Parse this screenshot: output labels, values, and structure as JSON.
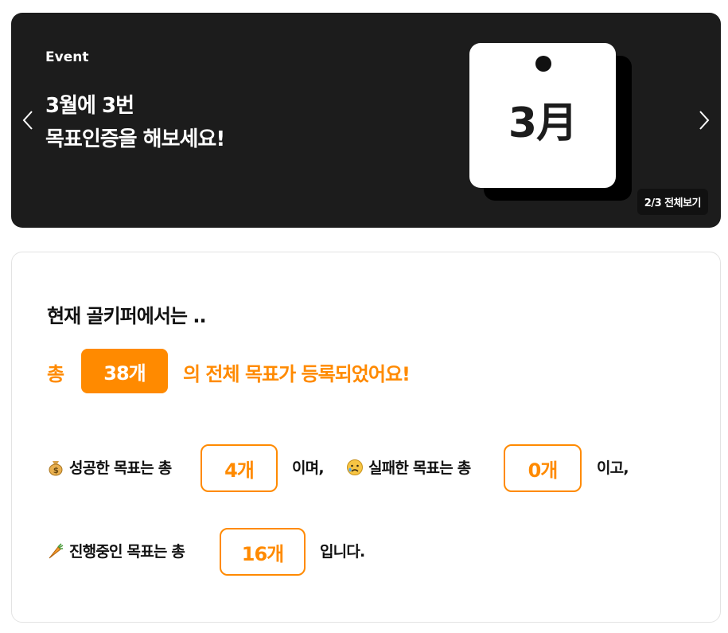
{
  "banner": {
    "event_label": "Event",
    "headline_line1": "3월에 3번",
    "headline_line2": "목표인증을 해보세요!",
    "calendar_month": "3月",
    "pager_text": "2/3 전체보기"
  },
  "stats": {
    "intro": "현재 골키퍼에서는 ..",
    "total_prefix": "총",
    "total_count": "38개",
    "total_suffix": "의 전체 목표가 등록되었어요!",
    "success_label": "성공한 목표는 총",
    "success_count": "4개",
    "success_suffix": "이며,",
    "fail_label": "실패한 목표는 총",
    "fail_count": "0개",
    "fail_suffix": "이고,",
    "progress_label": "진행중인 목표는 총",
    "progress_count": "16개",
    "progress_suffix": "입니다."
  },
  "icons": {
    "success": "money-bag-icon",
    "fail": "sad-face-icon",
    "progress": "carrot-icon"
  },
  "colors": {
    "accent": "#ff8a00",
    "banner_bg": "#1c1c1c"
  }
}
